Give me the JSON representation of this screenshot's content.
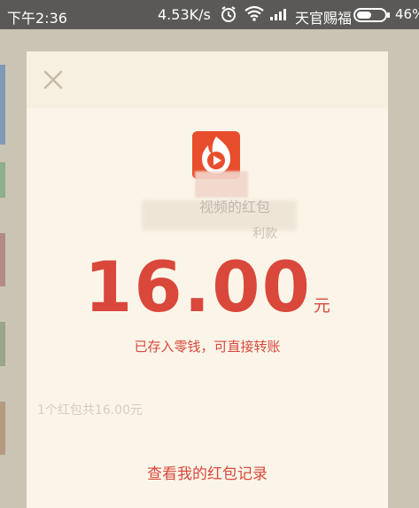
{
  "status_bar": {
    "time": "下午2:36",
    "network_speed": "4.53K/s",
    "carrier": "天官赐福",
    "battery_percent": "46%"
  },
  "dialog": {
    "sender_name": "视频的红包",
    "blessing": "利款",
    "amount": "16.00",
    "currency_unit": "元",
    "saved_note": "已存入零钱，可直接转账",
    "summary": "1个红包共16.00元",
    "record_link": "查看我的红包记录"
  },
  "colors": {
    "accent_red": "#d9483b",
    "dialog_bg": "#fbf5e9",
    "status_bar_bg": "#5a5957"
  },
  "icons": [
    "close-icon",
    "app-icon",
    "alarm-icon",
    "wifi-icon",
    "signal-icon",
    "battery-icon"
  ]
}
